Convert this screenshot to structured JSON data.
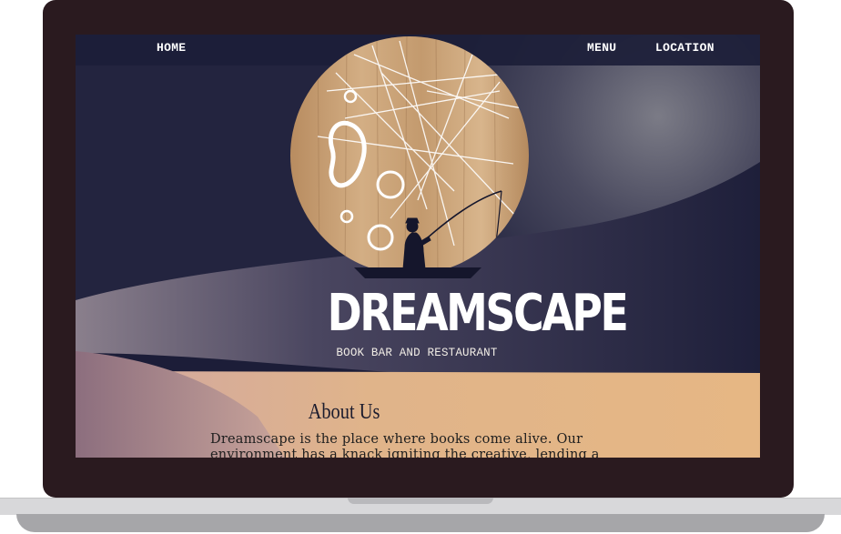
{
  "nav": {
    "home_label": "HOME",
    "menu_label": "MENU",
    "location_label": "LOCATION"
  },
  "brand": {
    "title": "DREAMSCAPE",
    "subtitle": "BOOK BAR AND RESTAURANT"
  },
  "about": {
    "heading": "About Us",
    "text": "Dreamscape is the place where books come alive. Our environment has a knack igniting the creative, lending a"
  },
  "colors": {
    "laptop_frame": "#2a1a1f",
    "night_sky": "#23243f",
    "sand": "#e3b586",
    "moon_wood": "#c9a27a"
  }
}
